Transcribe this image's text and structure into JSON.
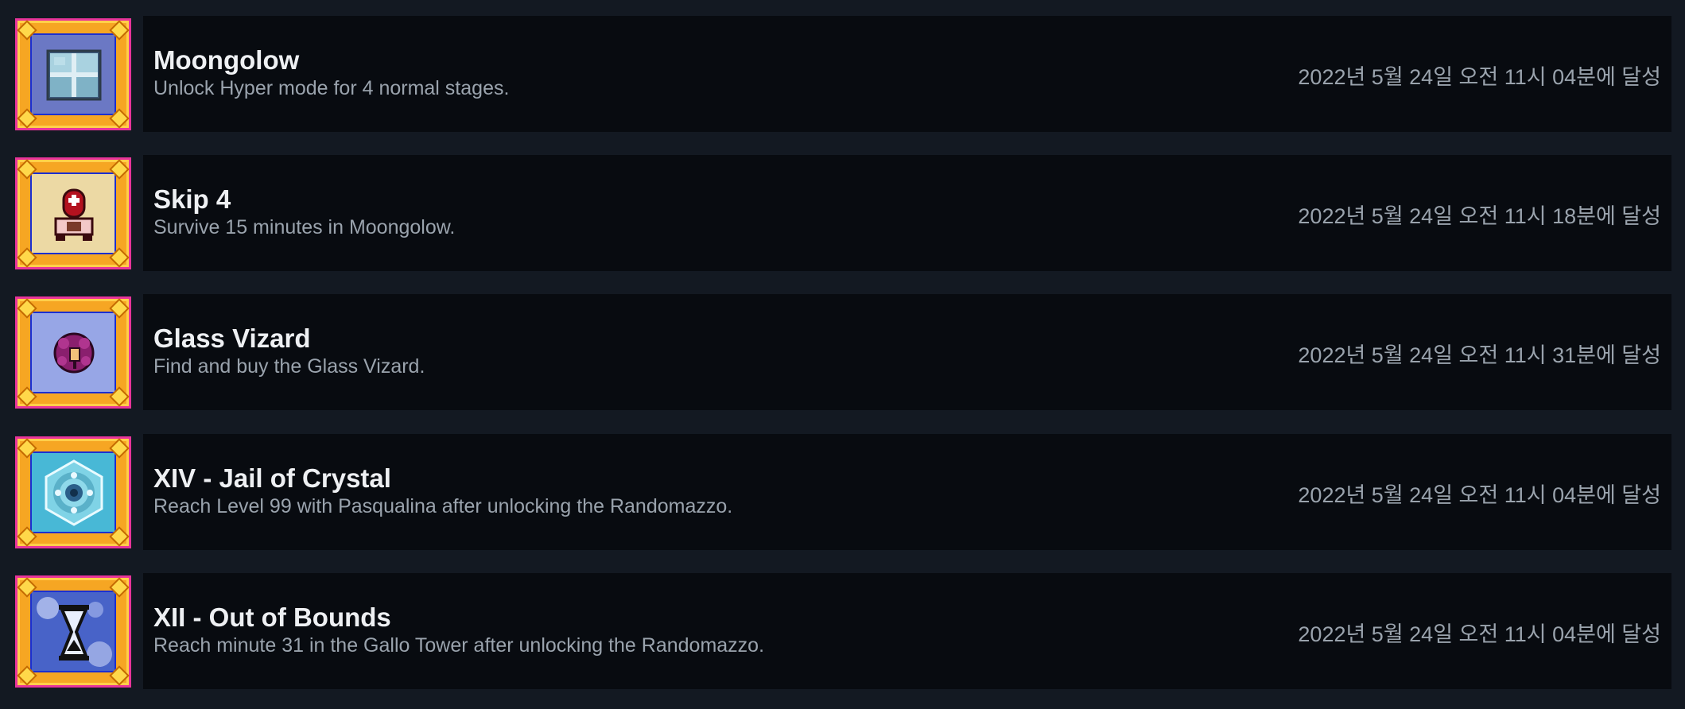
{
  "achievements": [
    {
      "title": "Moongolow",
      "description": "Unlock Hyper mode for 4 normal stages.",
      "unlocked": "2022년 5월 24일 오전 11시 04분에 달성",
      "icon": "moongolow-window-icon"
    },
    {
      "title": "Skip 4",
      "description": "Survive 15 minutes in Moongolow.",
      "unlocked": "2022년 5월 24일 오전 11시 18분에 달성",
      "icon": "skip4-figure-icon"
    },
    {
      "title": "Glass Vizard",
      "description": "Find and buy the Glass Vizard.",
      "unlocked": "2022년 5월 24일 오전 11시 31분에 달성",
      "icon": "glass-vizard-icon"
    },
    {
      "title": "XIV - Jail of Crystal",
      "description": "Reach Level 99 with Pasqualina after unlocking the Randomazzo.",
      "unlocked": "2022년 5월 24일 오전 11시 04분에 달성",
      "icon": "crystal-icon"
    },
    {
      "title": "XII - Out of Bounds",
      "description": "Reach minute 31 in the Gallo Tower after unlocking the Randomazzo.",
      "unlocked": "2022년 5월 24일 오전 11시 04분에 달성",
      "icon": "hourglass-icon"
    }
  ]
}
